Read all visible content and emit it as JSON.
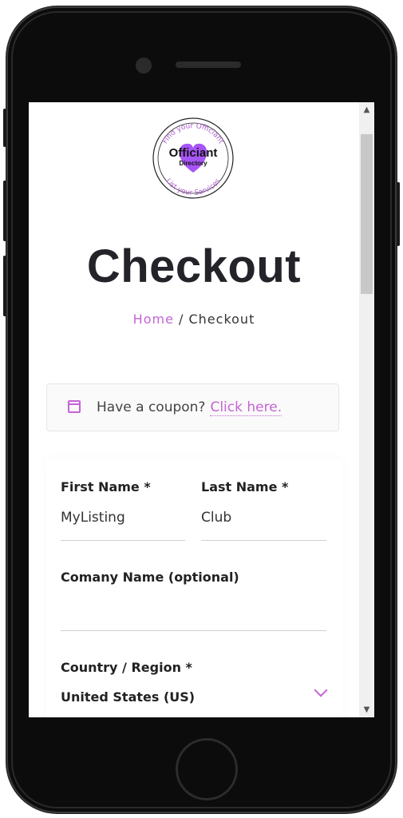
{
  "logo": {
    "top_text": "Find your Officiant",
    "name_line1": "Officiant",
    "name_line2": "Directory",
    "bottom_text": "List your Services",
    "accent_color": "#a855f7"
  },
  "page": {
    "title": "Checkout",
    "breadcrumb_home": "Home",
    "breadcrumb_separator": "/",
    "breadcrumb_current": "Checkout"
  },
  "coupon": {
    "icon": "calendar-icon",
    "prompt": "Have a coupon?",
    "link": "Click here."
  },
  "form": {
    "first_name_label": "First Name *",
    "first_name_value": "MyListing",
    "last_name_label": "Last Name *",
    "last_name_value": "Club",
    "company_label": "Comany Name (optional)",
    "company_value": "",
    "country_label": "Country / Region *",
    "country_value": "United States (US)",
    "chevron_icon": "chevron-down-icon"
  },
  "colors": {
    "accent": "#c564d6",
    "title": "#24232a"
  }
}
